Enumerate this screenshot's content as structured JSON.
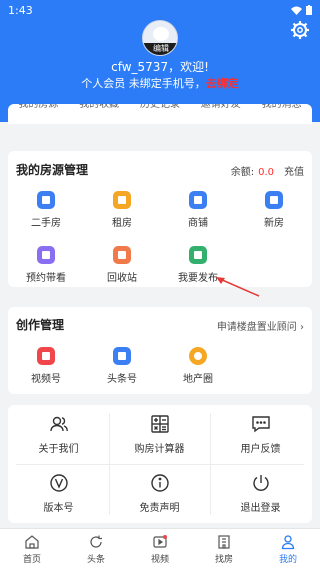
{
  "status": {
    "time": "1:43",
    "notify_icon": "A",
    "wifi_icon": "wifi-icon",
    "battery_icon": "battery-icon"
  },
  "profile": {
    "edit_label": "编辑",
    "greeting": "cfw_5737，欢迎!",
    "member_text": "个人会员  未绑定手机号，",
    "bind_label": "去绑定"
  },
  "tabs": [
    "我的房源",
    "我的收藏",
    "历史记录",
    "邀请好友",
    "我的消息"
  ],
  "listing_section": {
    "title": "我的房源管理",
    "balance_label": "余额:",
    "balance_value": "0.0",
    "recharge_label": "充值",
    "items": [
      {
        "label": "二手房",
        "color": "#3b7ff2"
      },
      {
        "label": "租房",
        "color": "#f5a623"
      },
      {
        "label": "商铺",
        "color": "#3b7ff2"
      },
      {
        "label": "新房",
        "color": "#3b7ff2"
      },
      {
        "label": "预约带看",
        "color": "#8a6ef2"
      },
      {
        "label": "回收站",
        "color": "#f07a4a"
      },
      {
        "label": "我要发布",
        "color": "#33b06e"
      }
    ]
  },
  "creation_section": {
    "title": "创作管理",
    "apply_label": "申请楼盘置业顾问",
    "items": [
      {
        "label": "视频号",
        "color": "#f0454a"
      },
      {
        "label": "头条号",
        "color": "#3b7ff2"
      },
      {
        "label": "地产圈",
        "color": "#f5a623"
      }
    ]
  },
  "utilities": [
    {
      "label": "关于我们",
      "icon": "users-icon"
    },
    {
      "label": "购房计算器",
      "icon": "calculator-icon"
    },
    {
      "label": "用户反馈",
      "icon": "chat-icon"
    },
    {
      "label": "版本号",
      "icon": "version-icon"
    },
    {
      "label": "免责声明",
      "icon": "info-icon"
    },
    {
      "label": "退出登录",
      "icon": "power-icon"
    }
  ],
  "bottom_nav": [
    {
      "label": "首页",
      "icon": "home-icon"
    },
    {
      "label": "头条",
      "icon": "refresh-icon"
    },
    {
      "label": "视频",
      "icon": "video-icon"
    },
    {
      "label": "找房",
      "icon": "building-icon"
    },
    {
      "label": "我的",
      "icon": "person-icon",
      "active": true
    }
  ],
  "colors": {
    "brand": "#2b7cf6",
    "alert": "#ff2d2d",
    "annotation_arrow": "#e53935"
  }
}
